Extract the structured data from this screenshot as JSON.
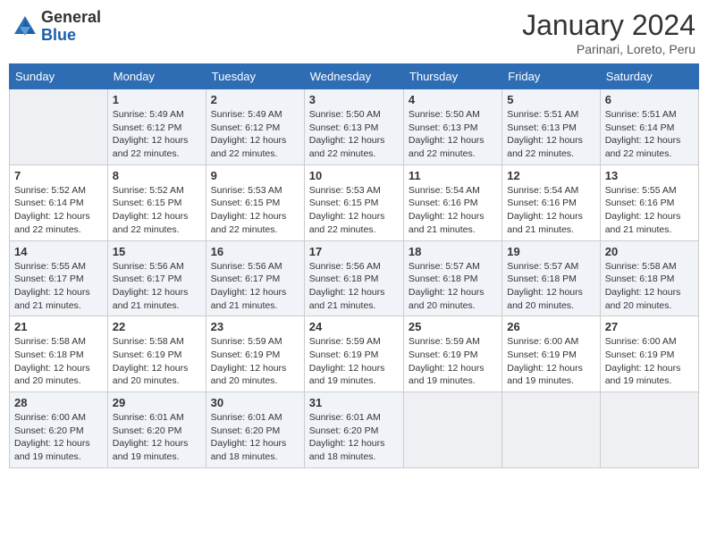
{
  "header": {
    "logo_general": "General",
    "logo_blue": "Blue",
    "month_title": "January 2024",
    "subtitle": "Parinari, Loreto, Peru"
  },
  "weekdays": [
    "Sunday",
    "Monday",
    "Tuesday",
    "Wednesday",
    "Thursday",
    "Friday",
    "Saturday"
  ],
  "weeks": [
    [
      {
        "day": "",
        "info": ""
      },
      {
        "day": "1",
        "info": "Sunrise: 5:49 AM\nSunset: 6:12 PM\nDaylight: 12 hours\nand 22 minutes."
      },
      {
        "day": "2",
        "info": "Sunrise: 5:49 AM\nSunset: 6:12 PM\nDaylight: 12 hours\nand 22 minutes."
      },
      {
        "day": "3",
        "info": "Sunrise: 5:50 AM\nSunset: 6:13 PM\nDaylight: 12 hours\nand 22 minutes."
      },
      {
        "day": "4",
        "info": "Sunrise: 5:50 AM\nSunset: 6:13 PM\nDaylight: 12 hours\nand 22 minutes."
      },
      {
        "day": "5",
        "info": "Sunrise: 5:51 AM\nSunset: 6:13 PM\nDaylight: 12 hours\nand 22 minutes."
      },
      {
        "day": "6",
        "info": "Sunrise: 5:51 AM\nSunset: 6:14 PM\nDaylight: 12 hours\nand 22 minutes."
      }
    ],
    [
      {
        "day": "7",
        "info": "Sunrise: 5:52 AM\nSunset: 6:14 PM\nDaylight: 12 hours\nand 22 minutes."
      },
      {
        "day": "8",
        "info": "Sunrise: 5:52 AM\nSunset: 6:15 PM\nDaylight: 12 hours\nand 22 minutes."
      },
      {
        "day": "9",
        "info": "Sunrise: 5:53 AM\nSunset: 6:15 PM\nDaylight: 12 hours\nand 22 minutes."
      },
      {
        "day": "10",
        "info": "Sunrise: 5:53 AM\nSunset: 6:15 PM\nDaylight: 12 hours\nand 22 minutes."
      },
      {
        "day": "11",
        "info": "Sunrise: 5:54 AM\nSunset: 6:16 PM\nDaylight: 12 hours\nand 21 minutes."
      },
      {
        "day": "12",
        "info": "Sunrise: 5:54 AM\nSunset: 6:16 PM\nDaylight: 12 hours\nand 21 minutes."
      },
      {
        "day": "13",
        "info": "Sunrise: 5:55 AM\nSunset: 6:16 PM\nDaylight: 12 hours\nand 21 minutes."
      }
    ],
    [
      {
        "day": "14",
        "info": "Sunrise: 5:55 AM\nSunset: 6:17 PM\nDaylight: 12 hours\nand 21 minutes."
      },
      {
        "day": "15",
        "info": "Sunrise: 5:56 AM\nSunset: 6:17 PM\nDaylight: 12 hours\nand 21 minutes."
      },
      {
        "day": "16",
        "info": "Sunrise: 5:56 AM\nSunset: 6:17 PM\nDaylight: 12 hours\nand 21 minutes."
      },
      {
        "day": "17",
        "info": "Sunrise: 5:56 AM\nSunset: 6:18 PM\nDaylight: 12 hours\nand 21 minutes."
      },
      {
        "day": "18",
        "info": "Sunrise: 5:57 AM\nSunset: 6:18 PM\nDaylight: 12 hours\nand 20 minutes."
      },
      {
        "day": "19",
        "info": "Sunrise: 5:57 AM\nSunset: 6:18 PM\nDaylight: 12 hours\nand 20 minutes."
      },
      {
        "day": "20",
        "info": "Sunrise: 5:58 AM\nSunset: 6:18 PM\nDaylight: 12 hours\nand 20 minutes."
      }
    ],
    [
      {
        "day": "21",
        "info": "Sunrise: 5:58 AM\nSunset: 6:18 PM\nDaylight: 12 hours\nand 20 minutes."
      },
      {
        "day": "22",
        "info": "Sunrise: 5:58 AM\nSunset: 6:19 PM\nDaylight: 12 hours\nand 20 minutes."
      },
      {
        "day": "23",
        "info": "Sunrise: 5:59 AM\nSunset: 6:19 PM\nDaylight: 12 hours\nand 20 minutes."
      },
      {
        "day": "24",
        "info": "Sunrise: 5:59 AM\nSunset: 6:19 PM\nDaylight: 12 hours\nand 19 minutes."
      },
      {
        "day": "25",
        "info": "Sunrise: 5:59 AM\nSunset: 6:19 PM\nDaylight: 12 hours\nand 19 minutes."
      },
      {
        "day": "26",
        "info": "Sunrise: 6:00 AM\nSunset: 6:19 PM\nDaylight: 12 hours\nand 19 minutes."
      },
      {
        "day": "27",
        "info": "Sunrise: 6:00 AM\nSunset: 6:19 PM\nDaylight: 12 hours\nand 19 minutes."
      }
    ],
    [
      {
        "day": "28",
        "info": "Sunrise: 6:00 AM\nSunset: 6:20 PM\nDaylight: 12 hours\nand 19 minutes."
      },
      {
        "day": "29",
        "info": "Sunrise: 6:01 AM\nSunset: 6:20 PM\nDaylight: 12 hours\nand 19 minutes."
      },
      {
        "day": "30",
        "info": "Sunrise: 6:01 AM\nSunset: 6:20 PM\nDaylight: 12 hours\nand 18 minutes."
      },
      {
        "day": "31",
        "info": "Sunrise: 6:01 AM\nSunset: 6:20 PM\nDaylight: 12 hours\nand 18 minutes."
      },
      {
        "day": "",
        "info": ""
      },
      {
        "day": "",
        "info": ""
      },
      {
        "day": "",
        "info": ""
      }
    ]
  ]
}
